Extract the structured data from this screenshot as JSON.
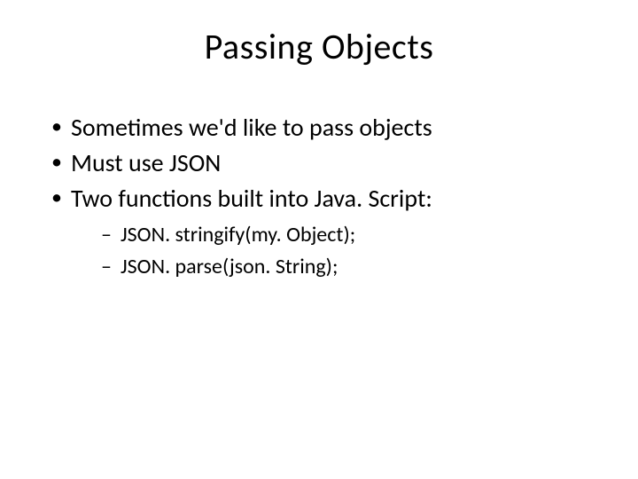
{
  "title": "Passing Objects",
  "bullets": [
    {
      "text": "Sometimes we'd like to pass objects"
    },
    {
      "text": "Must use JSON"
    },
    {
      "text": "Two functions built into Java. Script:"
    }
  ],
  "subbullets": [
    {
      "text": "JSON. stringify(my. Object);"
    },
    {
      "text": "JSON. parse(json. String);"
    }
  ]
}
